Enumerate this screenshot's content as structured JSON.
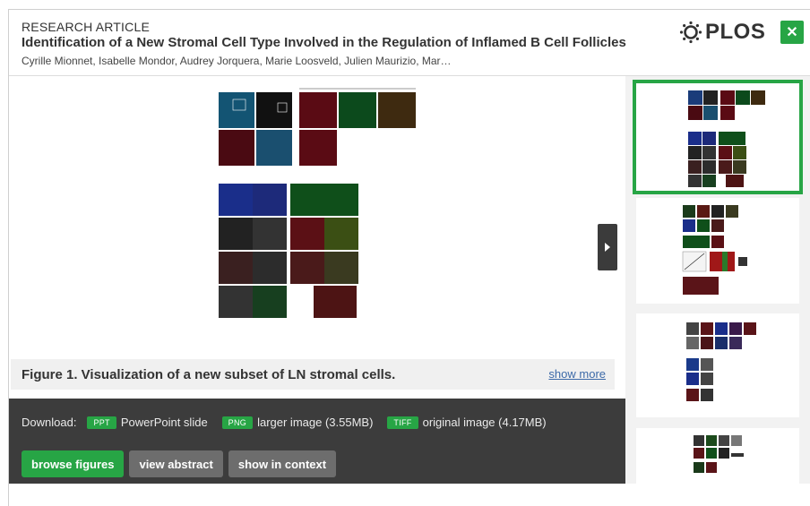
{
  "header": {
    "article_type": "RESEARCH ARTICLE",
    "title": "Identification of a New Stromal Cell Type Involved in the Regulation of Inflamed B Cell Follicles",
    "authors": "Cyrille Mionnet, Isabelle Mondor, Audrey Jorquera, Marie Loosveld, Julien Maurizio, Mar…"
  },
  "logo": {
    "text": "PLOS"
  },
  "close": {
    "icon": "close-icon",
    "glyph": "✕"
  },
  "figure": {
    "caption": "Figure 1. Visualization of a new subset of LN stromal cells.",
    "show_more": "show more"
  },
  "download": {
    "label": "Download:",
    "items": [
      {
        "tag": "PPT",
        "text": "PowerPoint slide"
      },
      {
        "tag": "PNG",
        "text": "larger image (3.55MB)"
      },
      {
        "tag": "TIFF",
        "text": "original image (4.17MB)"
      }
    ]
  },
  "buttons": {
    "browse": "browse figures",
    "abstract": "view abstract",
    "context": "show in context"
  },
  "colors": {
    "accent": "#27a545",
    "dark_panel": "#3c3c3c",
    "link": "#3d6aa8"
  }
}
